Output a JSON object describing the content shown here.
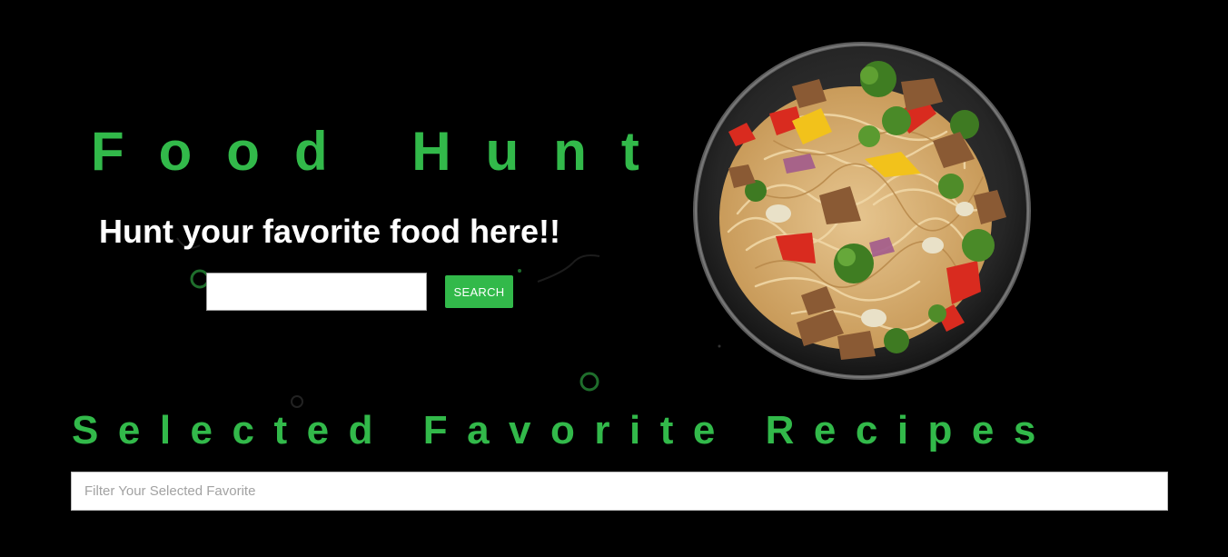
{
  "hero": {
    "title": "Food Hunt",
    "tagline": "Hunt your favorite food here!!",
    "search_value": "",
    "search_button_label": "SEARCH"
  },
  "favorites": {
    "title": "Selected Favorite Recipes",
    "filter_value": "",
    "filter_placeholder": "Filter Your Selected Favorite"
  },
  "theme": {
    "background": "#000000",
    "accent": "#32b94a",
    "text_light": "#ffffff"
  },
  "icons": {
    "hero_image": "noodle-dish-image",
    "decorations": "ring-decoration-icon"
  }
}
